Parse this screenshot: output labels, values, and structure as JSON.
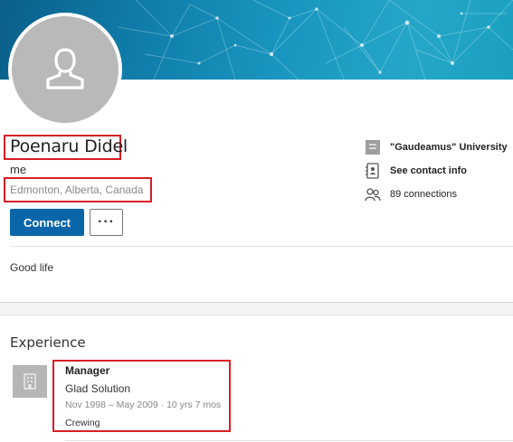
{
  "profile": {
    "name": "Poenaru Didel",
    "headline": "me",
    "location": "Edmonton, Alberta, Canada",
    "summary": "Good life"
  },
  "actions": {
    "connect_label": "Connect",
    "more_label": "···"
  },
  "sidebar": {
    "education": "\"Gaudeamus\" University",
    "contact": "See contact info",
    "connections": "89 connections"
  },
  "experience": {
    "title": "Experience",
    "items": [
      {
        "role": "Manager",
        "company": "Glad Solution",
        "dates": "Nov 1998 – May 2009 · 10 yrs 7 mos",
        "location": "Crewing"
      }
    ]
  },
  "colors": {
    "accent": "#0a66a8",
    "highlight_border": "#d81f26",
    "banner": "#1996bf"
  },
  "icons": {
    "avatar": "person-silhouette-icon",
    "education": "school-icon",
    "contact": "address-book-icon",
    "connections": "people-icon",
    "company": "building-icon"
  }
}
